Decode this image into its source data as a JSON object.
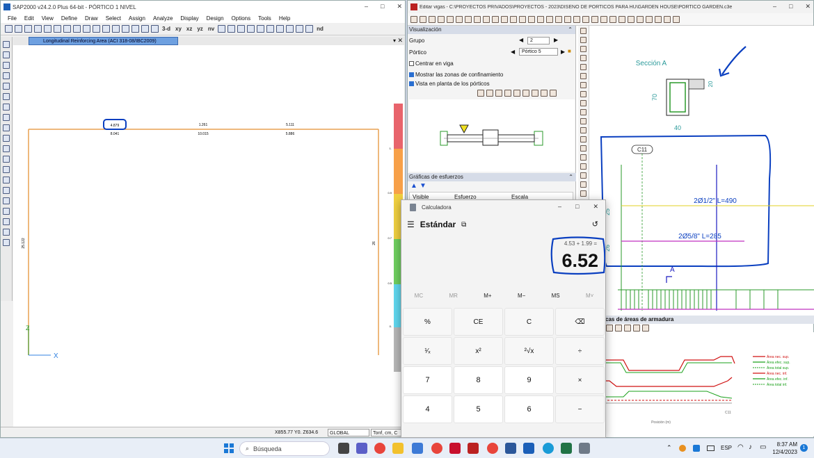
{
  "sap": {
    "title": "SAP2000 v24.2.0 Plus 64-bit - PÓRTICO 1 NIVEL",
    "menu": [
      "File",
      "Edit",
      "View",
      "Define",
      "Draw",
      "Select",
      "Assign",
      "Analyze",
      "Display",
      "Design",
      "Options",
      "Tools",
      "Help"
    ],
    "view_buttons": [
      "3-d",
      "xy",
      "xz",
      "yz",
      "nv",
      "nd"
    ],
    "tab_label": "Longitudinal Reinforcing Area  (ACI 318-08/IBC2009)",
    "beam_top_values": [
      "4.879",
      "1.261",
      "5.111"
    ],
    "beam_bottom_values": [
      "8.041",
      "10.015",
      "5.886"
    ],
    "col_left_value": "25.122",
    "col_right_value": "26",
    "scale_labels": [
      "1.",
      "0.9",
      "0.7",
      "0.5",
      "0."
    ],
    "axis_z": "Z",
    "axis_x": "X",
    "status_coords": "X855.77  Y0.  Z634.6",
    "status_system": "GLOBAL",
    "status_units": "Tonf, cm, C"
  },
  "editor": {
    "title": "Editar vigas - C:\\PROYECTOS PRIVADOS\\PROYECTOS - 2023\\DISEÑO DE PÓRTICOS PARA HU\\GARDEN HOUSE\\PÓRTICO GARDEN.c3e",
    "visualizacion_label": "Visualización",
    "grupo_label": "Grupo",
    "grupo_value": "2",
    "portico_label": "Pórtico",
    "portico_value": "Pórtico 5",
    "centrar_label": "Centrar en viga",
    "mostrar_label": "Mostrar las zonas de confinamiento",
    "vista_label": "Vista en planta de los pórticos",
    "graficas_label": "Gráficas de esfuerzos",
    "col_visible": "Visible",
    "col_esfuerzo": "Esfuerzo",
    "col_escala": "Escala",
    "seccion_title": "Sección A",
    "dim_h": "70",
    "dim_b": "40",
    "dim_20": "20",
    "col_tag": "C11",
    "bar_top": "2Ø1/2\" L=490",
    "bar_mid": "2Ø5/8\" L=285",
    "dim_25": "25",
    "dim_26": "26",
    "cut_label": "A",
    "arm_header": "cas de áreas de armadura",
    "legend": [
      "Área nec. sup.",
      "Área efec. sup.",
      "Área total sup.",
      "Área nec. inf.",
      "Área efec. inf.",
      "Área total inf."
    ],
    "c11_axis": "C11",
    "pos_label": "Posición (m)"
  },
  "calc": {
    "title": "Calculadora",
    "mode": "Estándar",
    "expression": "4.53 + 1.99 =",
    "result": "6.52",
    "memory": [
      "MC",
      "MR",
      "M+",
      "M−",
      "MS",
      "M˅"
    ],
    "keys": [
      "%",
      "CE",
      "C",
      "⌫",
      "¹⁄ₓ",
      "x²",
      "²√x",
      "÷",
      "7",
      "8",
      "9",
      "×",
      "4",
      "5",
      "6",
      "−"
    ]
  },
  "taskbar": {
    "search_placeholder": "Búsqueda",
    "lang": "ESP",
    "time": "8:37 AM",
    "date": "12/4/2023"
  },
  "colors": {
    "annotation_blue": "#0a3fc0",
    "beam_orange": "#e8a050",
    "rebar_green": "#1aa01a",
    "rebar_magenta": "#c030c0",
    "area_red": "#d01010"
  }
}
